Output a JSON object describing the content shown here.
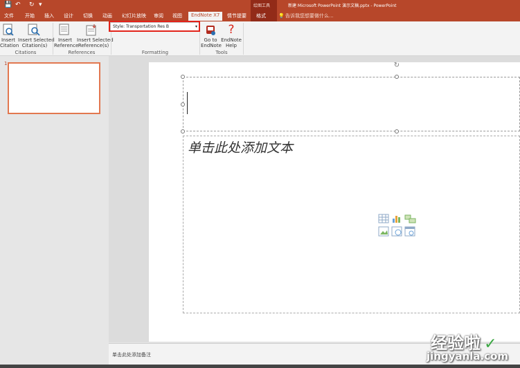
{
  "window": {
    "title": "新建 Microsoft PowerPoint 演示文稿.pptx - PowerPoint",
    "context_label": "绘图工具"
  },
  "quick_access": {
    "save_icon": "save-icon",
    "undo_icon": "undo-icon",
    "redo_icon": "redo-icon"
  },
  "tabs": [
    "文件",
    "开始",
    "插入",
    "设计",
    "切换",
    "动画",
    "幻灯片放映",
    "审阅",
    "视图",
    "EndNote X7",
    "情节提要",
    "格式"
  ],
  "tell_me": "告诉我您想要做什么...",
  "ribbon": {
    "citations": {
      "insert_citation": "Insert\nCitation",
      "insert_selected": "Insert Selected\nCitation(s)",
      "label": "Citations"
    },
    "references": {
      "insert_reference": "Insert\nReference",
      "insert_selected": "Insert Selected\nReference(s)",
      "label": "References"
    },
    "formatting": {
      "style": "Style: Transportation Res B",
      "label": "Formatting"
    },
    "tools": {
      "go_to": "Go to\nEndNote",
      "help": "EndNote\nHelp",
      "label": "Tools"
    }
  },
  "thumbnail": {
    "number": "1"
  },
  "slide": {
    "content_placeholder": "单击此处添加文本"
  },
  "notes": {
    "placeholder": "单击此处添加备注"
  },
  "watermark": {
    "text": "经验啦",
    "url": "jingyanla.com"
  }
}
